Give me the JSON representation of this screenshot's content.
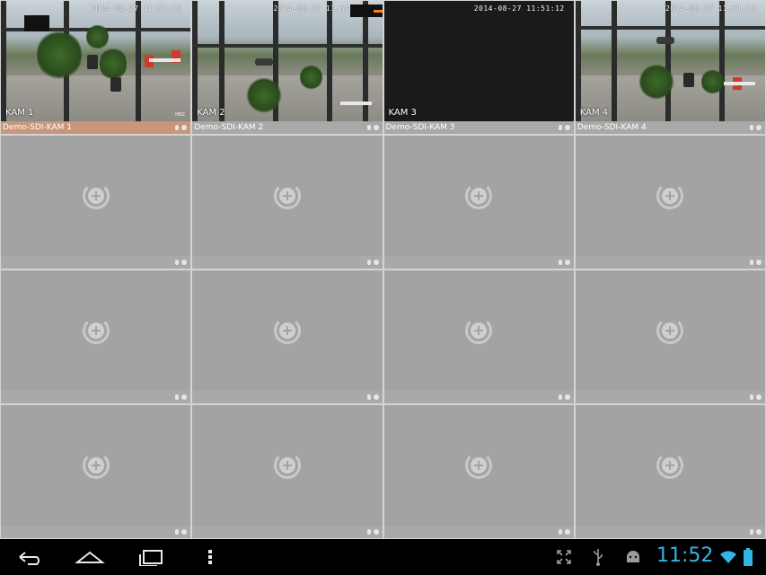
{
  "cameras": [
    {
      "label": "Demo-SDI-KAM 1",
      "osd_name": "KAM 1",
      "timestamp": "2014-08-27 11:51:12",
      "badge": "HDC"
    },
    {
      "label": "Demo-SDI-KAM 2",
      "osd_name": "KAM 2",
      "timestamp": "2014-08-27 11:51"
    },
    {
      "label": "Demo-SDI-KAM 3",
      "osd_name": "KAM 3",
      "timestamp": "2014-08-27 11:51:12"
    },
    {
      "label": "Demo-SDI-KAM 4",
      "osd_name": "KAM 4",
      "timestamp": "2014-08-27 11:51:12"
    }
  ],
  "empty_slot_icon": "add-camera-icon",
  "status_bar": {
    "clock": "11:52",
    "accent_color": "#33b5e5",
    "icons": [
      "fullscreen-icon",
      "usb-icon",
      "android-debug-icon",
      "wifi-icon",
      "battery-icon"
    ]
  },
  "nav_bar": {
    "icons": [
      "back-icon",
      "home-icon",
      "recent-apps-icon",
      "menu-icon"
    ]
  },
  "colors": {
    "selected_label": "#c8967a",
    "empty_tile": "#a3a3a3"
  }
}
